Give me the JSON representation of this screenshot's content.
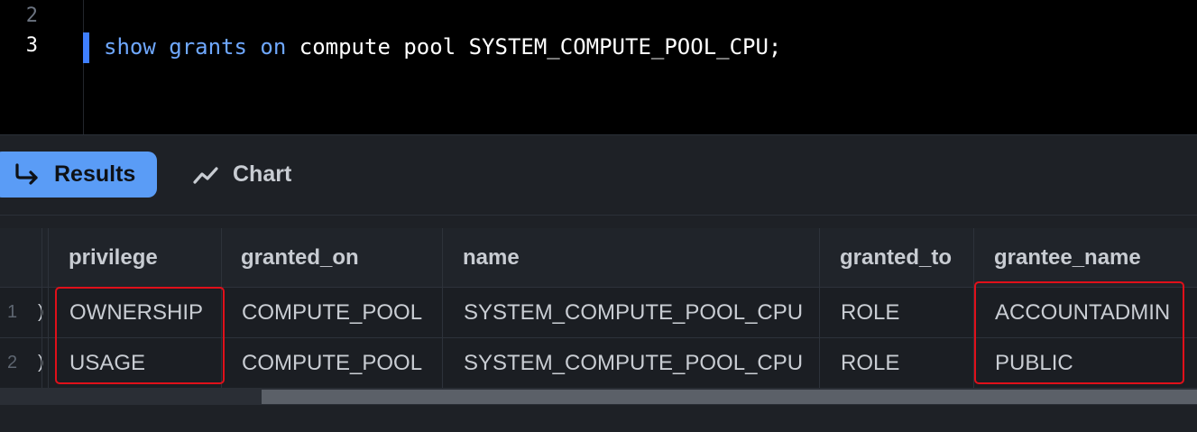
{
  "editor": {
    "lines": [
      {
        "number": "2",
        "code": ""
      },
      {
        "number": "3",
        "tokens": [
          {
            "text": "show",
            "kind": "keyword"
          },
          {
            "text": " "
          },
          {
            "text": "grants",
            "kind": "keyword"
          },
          {
            "text": " "
          },
          {
            "text": "on",
            "kind": "keyword"
          },
          {
            "text": " compute pool SYSTEM_COMPUTE_POOL_CPU;"
          }
        ]
      }
    ]
  },
  "tabs": {
    "results": {
      "label": "Results",
      "icon": "return-arrow-icon",
      "active": true
    },
    "chart": {
      "label": "Chart",
      "icon": "line-chart-icon"
    }
  },
  "table": {
    "columns": [
      "privilege",
      "granted_on",
      "name",
      "granted_to",
      "grantee_name"
    ],
    "rows": [
      {
        "rownum": "1",
        "stub": ")",
        "cells": [
          "OWNERSHIP",
          "COMPUTE_POOL",
          "SYSTEM_COMPUTE_POOL_CPU",
          "ROLE",
          "ACCOUNTADMIN"
        ]
      },
      {
        "rownum": "2",
        "stub": ")",
        "cells": [
          "USAGE",
          "COMPUTE_POOL",
          "SYSTEM_COMPUTE_POOL_CPU",
          "ROLE",
          "PUBLIC"
        ]
      }
    ]
  },
  "colors": {
    "accent": "#5a9cf6",
    "keyword": "#6fa8ff",
    "highlight": "#e0101a",
    "cursor": "#3f7fff"
  }
}
